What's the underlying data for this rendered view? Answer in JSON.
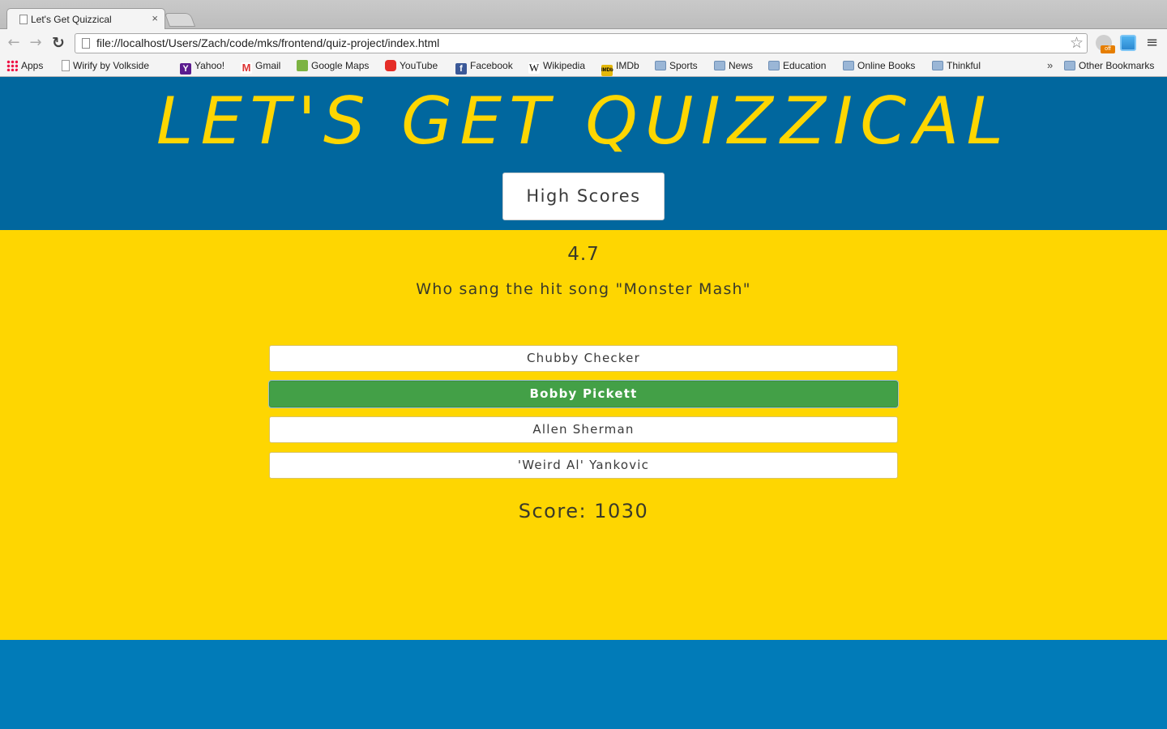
{
  "browser": {
    "tab_title": "Let's Get Quizzical",
    "tab_close": "×",
    "url": "file://localhost/Users/Zach/code/mks/frontend/quiz-project/index.html",
    "nav": {
      "back": "←",
      "forward": "→",
      "reload": "↻"
    },
    "star": "☆",
    "menu": "≡",
    "ext_badge": "off",
    "bookmarks": [
      {
        "label": "Apps",
        "icon": "apps-grid-icon"
      },
      {
        "label": "Wirify by Volkside",
        "icon": "page-icon"
      },
      {
        "label": "Yahoo!",
        "icon": "yahoo-icon",
        "glyph": "Y"
      },
      {
        "label": "Gmail",
        "icon": "gmail-icon",
        "glyph": "M"
      },
      {
        "label": "Google Maps",
        "icon": "maps-icon"
      },
      {
        "label": "YouTube",
        "icon": "youtube-icon"
      },
      {
        "label": "Facebook",
        "icon": "facebook-icon",
        "glyph": "f"
      },
      {
        "label": "Wikipedia",
        "icon": "wikipedia-icon",
        "glyph": "W"
      },
      {
        "label": "IMDb",
        "icon": "imdb-icon",
        "glyph": "IMDb"
      },
      {
        "label": "Sports",
        "icon": "folder-icon"
      },
      {
        "label": "News",
        "icon": "folder-icon"
      },
      {
        "label": "Education",
        "icon": "folder-icon"
      },
      {
        "label": "Online Books",
        "icon": "folder-icon"
      },
      {
        "label": "Thinkful",
        "icon": "folder-icon"
      }
    ],
    "bookmarks_overflow": "»",
    "other_bookmarks": "Other Bookmarks"
  },
  "page": {
    "title": "LET'S GET QUIZZICAL",
    "high_scores_label": "High Scores",
    "timer": "4.7",
    "question": "Who sang the hit song \"Monster Mash\"",
    "answers": [
      {
        "label": "Chubby Checker",
        "state": "default"
      },
      {
        "label": "Bobby Pickett",
        "state": "correct"
      },
      {
        "label": "Allen Sherman",
        "state": "default"
      },
      {
        "label": "'Weird Al' Yankovic",
        "state": "default"
      }
    ],
    "score": "Score: 1030"
  },
  "colors": {
    "header_blue": "#01679e",
    "footer_blue": "#017bb8",
    "yellow": "#fed601",
    "correct_green": "#43a047"
  }
}
